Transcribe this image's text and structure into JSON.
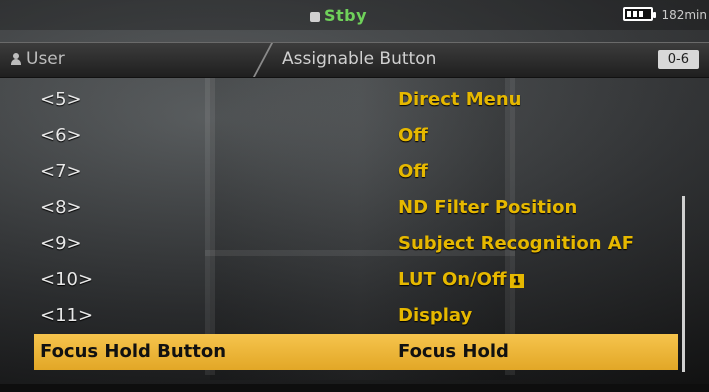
{
  "status": {
    "mode": "Stby",
    "battery_time": "182min"
  },
  "header": {
    "tab": "User",
    "title": "Assignable Button",
    "page_indicator": "0-6"
  },
  "menu": {
    "rows": [
      {
        "key": "<5>",
        "value": "Direct Menu"
      },
      {
        "key": "<6>",
        "value": "Off"
      },
      {
        "key": "<7>",
        "value": "Off"
      },
      {
        "key": "<8>",
        "value": "ND Filter Position"
      },
      {
        "key": "<9>",
        "value": "Subject Recognition AF"
      },
      {
        "key": "<10>",
        "value": "LUT On/Off",
        "badge": "1"
      },
      {
        "key": "<11>",
        "value": "Display"
      }
    ],
    "selected": {
      "key": "Focus Hold Button",
      "value": "Focus Hold"
    }
  },
  "colors": {
    "accent_yellow": "#e6b800",
    "selected_bg": "#f1b83a",
    "standby_green": "#6fd15a"
  }
}
